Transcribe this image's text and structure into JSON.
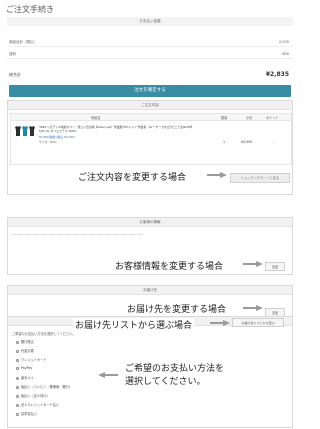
{
  "page": {
    "title": "ご注文手続き"
  },
  "summary": {
    "header": "お支払い金額",
    "rows": [
      {
        "label": "商品合計（税込）",
        "value": "2,035"
      },
      {
        "label": "送料",
        "value": "800"
      }
    ],
    "total_label": "総合計",
    "total_value": "¥2,835",
    "confirm_button": "注文を確定する"
  },
  "order": {
    "header": "ご注文内容",
    "columns": {
      "product": "商品名",
      "qty": "数量",
      "subtotal": "小計",
      "points": "ポイント"
    },
    "item": {
      "name": "3064 リガテッキ地獄カペン・悪しい合意後【Kokuryoe】 作業服 PTCシャツ 作業着 【メーカーカタログどこでもNOTE】 S/S〜XL ポリエステル 100%",
      "price": "¥1,800(税抜)(税込 ¥2,035)",
      "size": "サイズ：M(S)",
      "qty": "1",
      "subtotal": "¥2,000",
      "points": "-"
    },
    "change_cart_button": "ショッピングカートに戻る",
    "annotation": "ご注文内容を変更する場合"
  },
  "customer": {
    "header": "お客様の情報",
    "edit_button": "変更",
    "annotation": "お客様情報を変更する場合"
  },
  "shipping": {
    "header": "お届け先",
    "edit_button": "変更",
    "annotation": "お届け先を変更する場合",
    "list_button": "お届け先リストから選ぶ",
    "list_annotation": "お届け先リストから選ぶ場合"
  },
  "payment": {
    "header": "お支払い方法",
    "intro": "ご希望のお支払い方法を選択してください。",
    "options": [
      "銀行振込",
      "代金引換",
      "クレジットカード",
      "PayPay",
      "楽天ペイ",
      "後払い（コンビニ・郵便局・銀行）",
      "後払い（法人向け）",
      "法人クレジットカード払い",
      "請求書払い"
    ],
    "annotation_line1": "ご希望のお支払い方法を",
    "annotation_line2": "選択してください。"
  }
}
